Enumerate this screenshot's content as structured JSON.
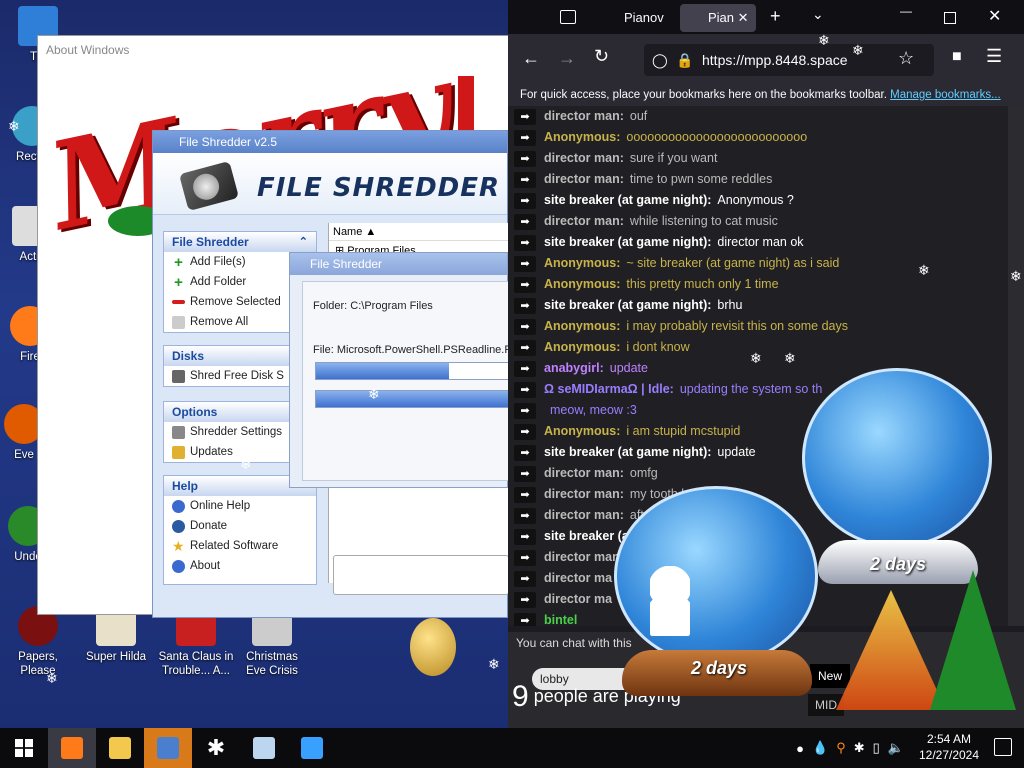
{
  "desktop": {
    "icons": [
      {
        "label": "Thi",
        "color": "#2f7fd8"
      },
      {
        "label": "Recyc",
        "color": "#3aa0c8"
      },
      {
        "label": "Activ",
        "color": "#ddd"
      },
      {
        "label": "Fire",
        "color": "#ff7b19"
      },
      {
        "label": "Eve",
        "color": "#e05a00"
      },
      {
        "label": "Unde",
        "color": "#2a8a2a"
      },
      {
        "label": "Papers, Please",
        "color": "#7a1010"
      },
      {
        "label": "Super Hilda",
        "color": "#e8e0c8"
      },
      {
        "label": "Santa Claus in Trouble... A...",
        "color": "#c82020"
      },
      {
        "label": "Christmas Eve Crisis",
        "color": "#cccccc"
      }
    ]
  },
  "about_window": {
    "title": "About Windows",
    "banner_text": "Merry"
  },
  "file_shredder": {
    "title": "File Shredder v2.5",
    "logo_text": "FILE SHREDDER",
    "sections": {
      "file_shredder": {
        "heading": "File Shredder",
        "items": [
          "Add File(s)",
          "Add Folder",
          "Remove Selected",
          "Remove All"
        ]
      },
      "disks": {
        "heading": "Disks",
        "items": [
          "Shred Free Disk S"
        ]
      },
      "options": {
        "heading": "Options",
        "items": [
          "Shredder Settings",
          "Updates"
        ]
      },
      "help": {
        "heading": "Help",
        "items": [
          "Online Help",
          "Donate",
          "Related Software",
          "About"
        ]
      }
    },
    "list": {
      "column_name": "Name",
      "row_1": "Program Files"
    }
  },
  "progress_dialog": {
    "title": "File Shredder",
    "folder_text": "Folder: C:\\Program Files",
    "file_text": "File: Microsoft.PowerShell.PSReadline.Re",
    "progress_1": 0.67,
    "progress_2": 1.0
  },
  "browser": {
    "tabs": [
      "Pianov",
      "Pian"
    ],
    "url": "https://mpp.8448.space",
    "bookmark_hint": "For quick access, place your bookmarks here on the bookmarks toolbar.",
    "bookmark_link": "Manage bookmarks...",
    "chat": [
      {
        "who": "director man:",
        "text": "ouf",
        "color": "#bbbbbb"
      },
      {
        "who": "Anonymous:",
        "text": "oooooooooooooooooooooooooo",
        "color": "#c8b24a"
      },
      {
        "who": "director man:",
        "text": "sure if you want",
        "color": "#bbbbbb"
      },
      {
        "who": "director man:",
        "text": "time to pwn some reddles",
        "color": "#bbbbbb"
      },
      {
        "who": "site breaker (at game night):",
        "text": "Anonymous  ?",
        "color": "#ffffff"
      },
      {
        "who": "director man:",
        "text": "while listening to cat music",
        "color": "#bbbbbb"
      },
      {
        "who": "site breaker (at game night):",
        "text": "director man  ok",
        "color": "#ffffff"
      },
      {
        "who": "Anonymous:",
        "text": "~ site breaker (at game night)   as i said",
        "color": "#c8b24a"
      },
      {
        "who": "Anonymous:",
        "text": "this pretty much only 1 time",
        "color": "#c8b24a"
      },
      {
        "who": "site breaker (at game night):",
        "text": "brhu",
        "color": "#ffffff"
      },
      {
        "who": "Anonymous:",
        "text": "i may probably revisit this on some days",
        "color": "#c8b24a"
      },
      {
        "who": "Anonymous:",
        "text": "i dont know",
        "color": "#c8b24a"
      },
      {
        "who": "anabygirl:",
        "text": "update",
        "color": "#c080ff"
      },
      {
        "who": "Ω seMIDIarmaΩ | Idle:",
        "text": "updating the system so th",
        "color": "#9a7dff"
      },
      {
        "who": "",
        "text": "meow, meow :3",
        "color": "#9a7dff"
      },
      {
        "who": "Anonymous:",
        "text": "i am stupid mcstupid",
        "color": "#c8b24a"
      },
      {
        "who": "site breaker (at game night):",
        "text": "update",
        "color": "#ffffff"
      },
      {
        "who": "director man:",
        "text": "omfg",
        "color": "#bbbbbb"
      },
      {
        "who": "director man:",
        "text": "my tooth hurts",
        "color": "#bbbbbb"
      },
      {
        "who": "director man:",
        "text": "afte",
        "color": "#bbbbbb"
      },
      {
        "who": "site breaker (at",
        "text": "",
        "color": "#ffffff"
      },
      {
        "who": "director man",
        "text": "",
        "color": "#bbbbbb"
      },
      {
        "who": "director ma",
        "text": "",
        "color": "#bbbbbb"
      },
      {
        "who": "director ma",
        "text": "",
        "color": "#bbbbbb"
      },
      {
        "who": "bintel",
        "text": "",
        "color": "#4ad04a"
      }
    ],
    "chat_hint": "You can chat with this",
    "room": "lobby",
    "player_count": "9",
    "players_label": "people are playing",
    "new_label": "New",
    "midi_label": "MID"
  },
  "globes": [
    {
      "label": "2 days"
    },
    {
      "label": "2 days"
    }
  ],
  "taskbar": {
    "time": "2:54 AM",
    "date": "12/27/2024",
    "apps": [
      {
        "name": "firefox",
        "color": "#ff7b19"
      },
      {
        "name": "explorer",
        "color": "#f2c94c"
      },
      {
        "name": "shredder",
        "color": "#4a7fd0"
      },
      {
        "name": "snowflake",
        "color": "#ffffff"
      },
      {
        "name": "window-app",
        "color": "#bcd6f0"
      },
      {
        "name": "bucket",
        "color": "#3aa0ff"
      }
    ]
  }
}
